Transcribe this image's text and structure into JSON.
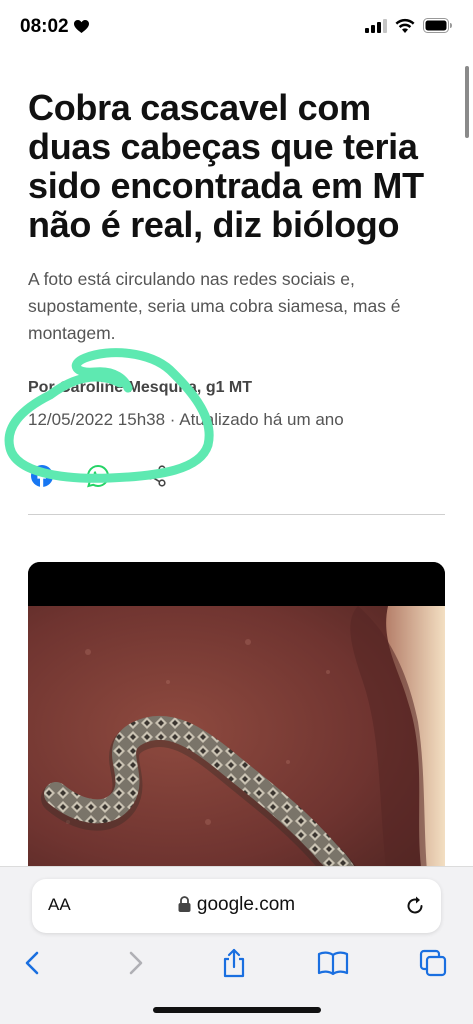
{
  "status_bar": {
    "time": "08:02",
    "icons": [
      "heart-icon",
      "signal-icon",
      "wifi-icon",
      "battery-icon"
    ]
  },
  "article": {
    "headline": "Cobra cascavel com duas cabeças que teria sido encontrada em MT não é real, diz biólogo",
    "subtitle": "A foto está circulando nas redes sociais e, supostamente, seria uma cobra siamesa, mas é montagem.",
    "byline": "Por Caroline Mesquita, g1 MT",
    "dateline": "12/05/2022 15h38 · Atualizado há um ano",
    "share_icons": [
      "facebook-icon",
      "whatsapp-icon",
      "share-icon"
    ]
  },
  "annotation": {
    "color": "#5ee9b1"
  },
  "colors": {
    "facebook": "#1877f2",
    "whatsapp": "#25d366",
    "ios_blue": "#1a6fe0",
    "ios_gray": "#b0b0b5"
  },
  "browser": {
    "text_size_label": "AA",
    "url": "google.com",
    "toolbar_icons": [
      "back-icon",
      "forward-icon",
      "share-icon",
      "bookmarks-icon",
      "tabs-icon"
    ]
  }
}
